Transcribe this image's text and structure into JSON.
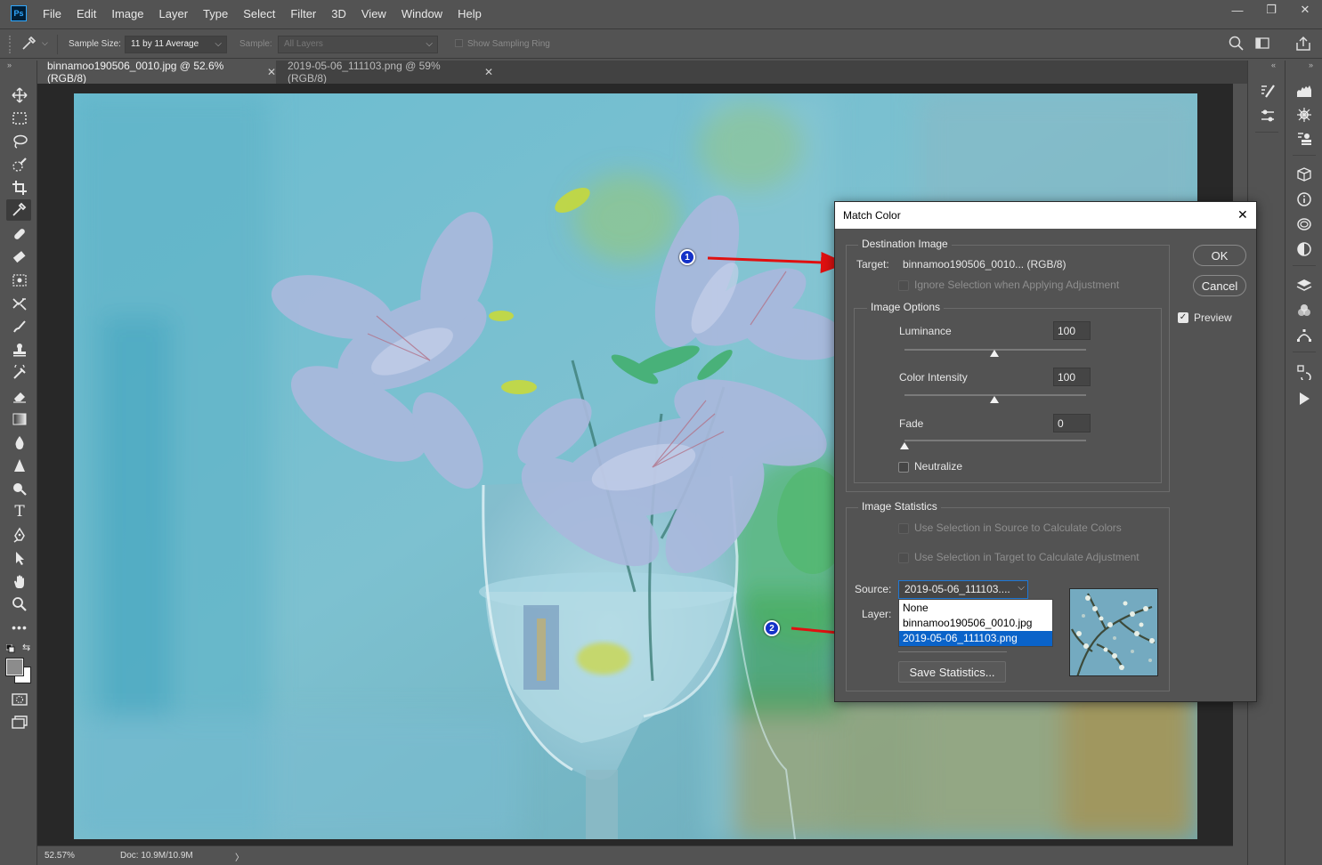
{
  "app": {
    "logo": "Ps",
    "menu": [
      "File",
      "Edit",
      "Image",
      "Layer",
      "Type",
      "Select",
      "Filter",
      "3D",
      "View",
      "Window",
      "Help"
    ],
    "window_controls": [
      "—",
      "❐",
      "✕"
    ]
  },
  "options_bar": {
    "sample_size_label": "Sample Size:",
    "sample_size_value": "11 by 11 Average",
    "sample_label": "Sample:",
    "sample_value": "All Layers",
    "show_sampling_ring": "Show Sampling Ring"
  },
  "tabs": [
    {
      "label": "binnamoo190506_0010.jpg @ 52.6% (RGB/8)",
      "active": true
    },
    {
      "label": "2019-05-06_111103.png @ 59% (RGB/8)",
      "active": false
    }
  ],
  "status": {
    "zoom": "52.57%",
    "doc": "Doc: 10.9M/10.9M",
    "arrow": "〉"
  },
  "dialog": {
    "title": "Match Color",
    "close": "✕",
    "destination": {
      "title": "Destination Image",
      "target_label": "Target:",
      "target_value": "binnamoo190506_0010... (RGB/8)",
      "ignore_selection": "Ignore Selection when Applying Adjustment"
    },
    "image_options": {
      "title": "Image Options",
      "luminance_label": "Luminance",
      "luminance_value": "100",
      "luminance": 100,
      "color_intensity_label": "Color Intensity",
      "color_intensity_value": "100",
      "color_intensity": 100,
      "fade_label": "Fade",
      "fade_value": "0",
      "fade": 0,
      "neutralize_label": "Neutralize"
    },
    "statistics": {
      "title": "Image Statistics",
      "use_sel_source": "Use Selection in Source to Calculate Colors",
      "use_sel_target": "Use Selection in Target to Calculate Adjustment",
      "source_label": "Source:",
      "source_value": "2019-05-06_111103....",
      "source_options": [
        "None",
        "binnamoo190506_0010.jpg",
        "2019-05-06_111103.png"
      ],
      "layer_label": "Layer:",
      "save_statistics": "Save Statistics..."
    },
    "ok": "OK",
    "cancel": "Cancel",
    "preview_label": "Preview",
    "preview_checked": true
  },
  "annotations": {
    "marker1": "1",
    "marker2": "2",
    "arrow_color": "#e01010"
  }
}
